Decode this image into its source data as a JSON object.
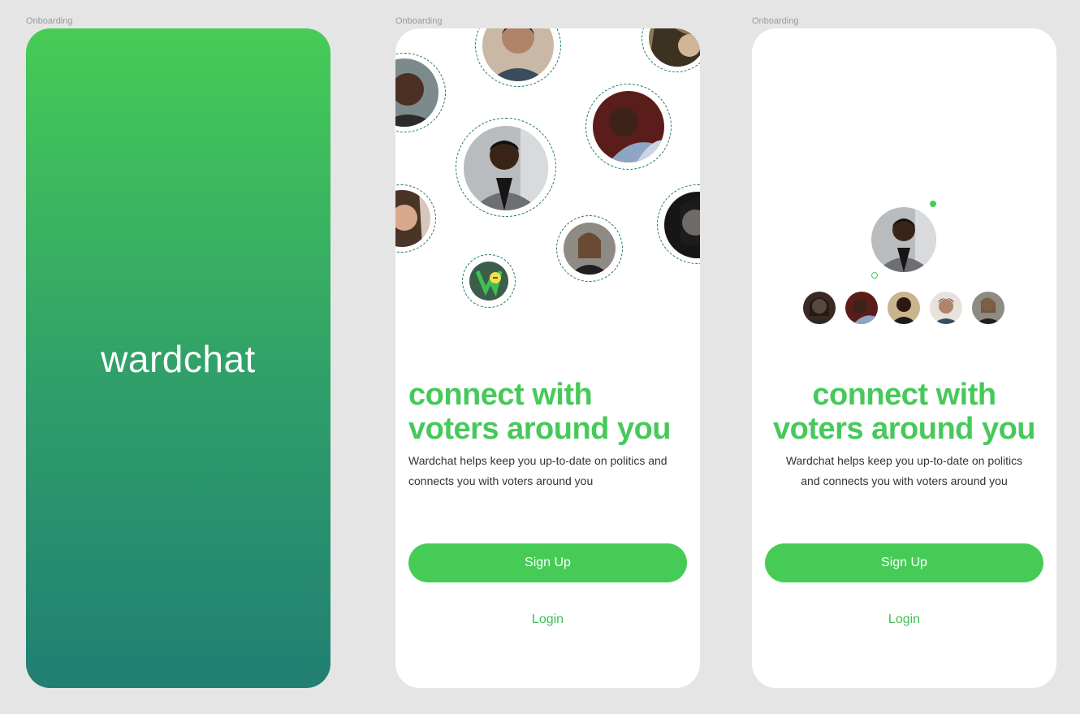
{
  "frames": [
    {
      "label": "Onboarding"
    },
    {
      "label": "Onboarding"
    },
    {
      "label": "Onboarding"
    }
  ],
  "splash": {
    "logo_text": "wardchat"
  },
  "onboarding": {
    "headline_left": "connect with voters around you",
    "headline_right": "connect with voters around you",
    "description": "Wardchat helps keep you up-to-date on politics and connects you with voters around you",
    "signup_label": "Sign Up",
    "login_label": "Login"
  },
  "colors": {
    "brand_green": "#46cc56",
    "gradient_bottom": "#217f73",
    "dashed_ring": "#1f7a5c"
  },
  "icons": {
    "app_logo": "wardchat-logo-icon"
  }
}
